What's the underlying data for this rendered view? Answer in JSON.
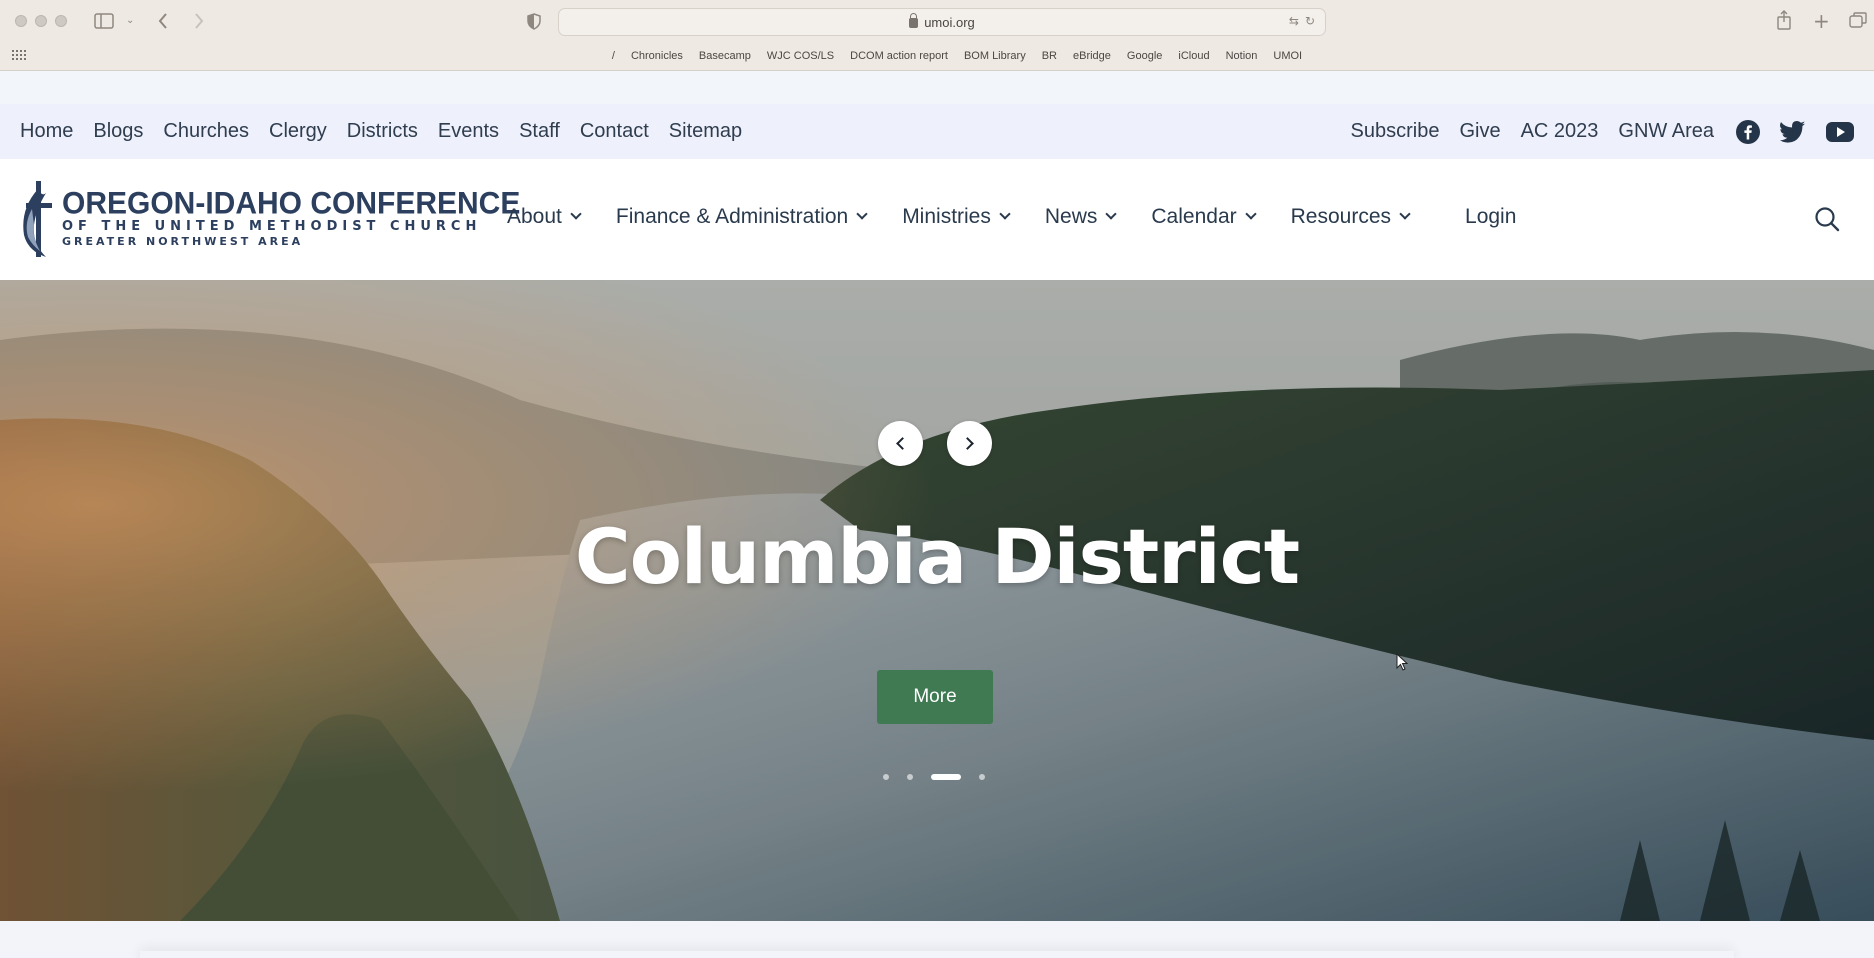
{
  "browser": {
    "url": "umoi.org",
    "bookmarks": [
      "/",
      "Chronicles",
      "Basecamp",
      "WJC COS/LS",
      "DCOM action report",
      "BOM Library",
      "BR",
      "eBridge",
      "Google",
      "iCloud",
      "Notion",
      "UMOI"
    ]
  },
  "utility_nav": {
    "left": [
      "Home",
      "Blogs",
      "Churches",
      "Clergy",
      "Districts",
      "Events",
      "Staff",
      "Contact",
      "Sitemap"
    ],
    "right": [
      "Subscribe",
      "Give",
      "AC 2023",
      "GNW Area"
    ],
    "social_icons": [
      "facebook-icon",
      "twitter-icon",
      "youtube-icon"
    ]
  },
  "logo": {
    "line1": "OREGON-IDAHO CONFERENCE",
    "line2": "OF THE UNITED METHODIST CHURCH",
    "line3": "GREATER NORTHWEST AREA"
  },
  "main_nav": {
    "items": [
      "About",
      "Finance & Administration",
      "Ministries",
      "News",
      "Calendar",
      "Resources"
    ],
    "login": "Login"
  },
  "hero": {
    "title": "Columbia District",
    "button": "More",
    "slides_total": 4,
    "active_slide": 3
  },
  "colors": {
    "utility_bg": "#eef1fb",
    "logo_navy": "#2c3f5e",
    "more_button": "#3f7a52"
  }
}
